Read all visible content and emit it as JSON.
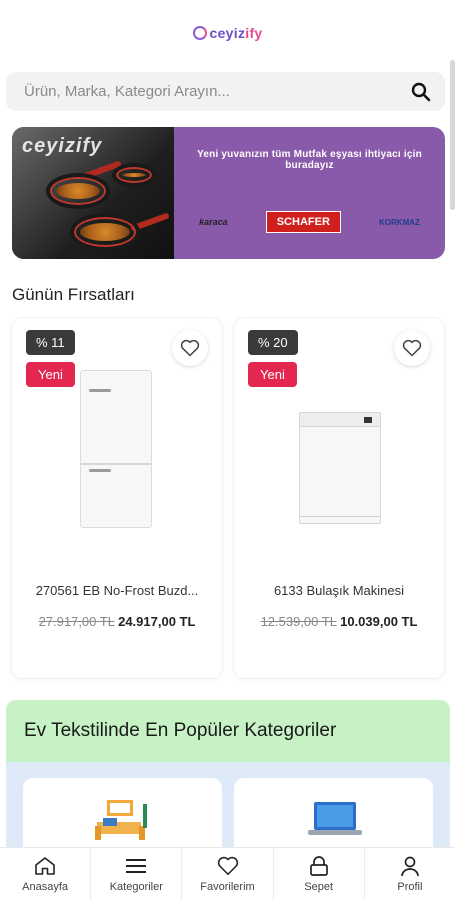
{
  "header": {
    "logo_text": "ceyiz",
    "logo_accent": "ify"
  },
  "search": {
    "placeholder": "Ürün, Marka, Kategori Arayın...",
    "icon": "search-icon"
  },
  "banner": {
    "brand_overlay": "ceyizify",
    "headline": "Yeni yuvanızın tüm Mutfak eşyası ihtiyacı için buradayız",
    "brands": [
      "karaca",
      "SCHAFER",
      "KORKMAZ"
    ],
    "background_color": "#8a5aaa"
  },
  "deals": {
    "title": "Günün Fırsatları",
    "products": [
      {
        "discount": "% 11",
        "badge": "Yeni",
        "name": "270561 EB No-Frost Buzd...",
        "old_price": "27.917,00 TL",
        "new_price": "24.917,00 TL",
        "image": "refrigerator"
      },
      {
        "discount": "% 20",
        "badge": "Yeni",
        "name": "6133 Bulaşık Makinesi",
        "old_price": "12.539,00 TL",
        "new_price": "10.039,00 TL",
        "image": "dishwasher"
      }
    ]
  },
  "popular": {
    "title": "Ev Tekstilinde En Popüler Kategoriler"
  },
  "bottom_nav": {
    "items": [
      {
        "label": "Anasayfa",
        "icon": "home-icon"
      },
      {
        "label": "Kategoriler",
        "icon": "menu-icon"
      },
      {
        "label": "Favorilerim",
        "icon": "heart-icon"
      },
      {
        "label": "Sepet",
        "icon": "lock-bag-icon"
      },
      {
        "label": "Profil",
        "icon": "user-icon"
      }
    ]
  },
  "colors": {
    "badge_new": "#e32750",
    "badge_discount": "#3a3a3a",
    "popular_header_bg": "#c6f2c5",
    "popular_body_bg": "#dfeaf8"
  }
}
